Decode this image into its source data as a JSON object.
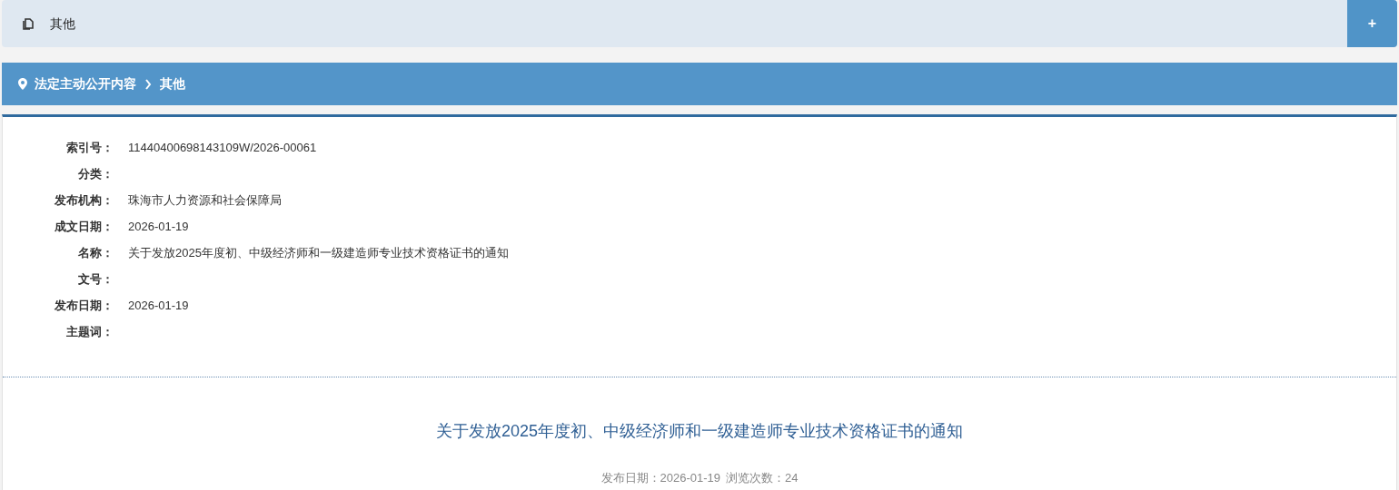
{
  "top_bar": {
    "title": "其他",
    "add_button": "+"
  },
  "breadcrumb": [
    "法定主动公开内容",
    "其他"
  ],
  "metadata": [
    {
      "label": "索引号：",
      "value": "11440400698143109W/2026-00061"
    },
    {
      "label": "分类："
    },
    {
      "label": "发布机构：",
      "value": "珠海市人力资源和社会保障局"
    },
    {
      "label": "成文日期：",
      "value": "2026-01-19"
    },
    {
      "label": "名称：",
      "value": "关于发放2025年度初、中级经济师和一级建造师专业技术资格证书的通知"
    },
    {
      "label": "文号："
    },
    {
      "label": "发布日期：",
      "value": "2026-01-19"
    },
    {
      "label": "主题词："
    }
  ],
  "article": {
    "title": "关于发放2025年度初、中级经济师和一级建造师专业技术资格证书的通知",
    "publish_date": "发布日期：2026-01-19",
    "views": "浏览次数：24"
  }
}
